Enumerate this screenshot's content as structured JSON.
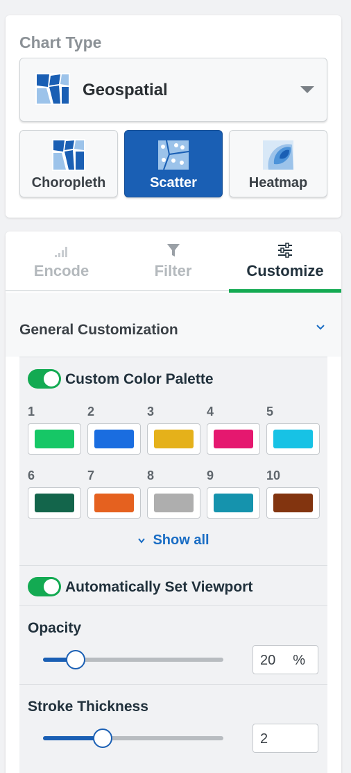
{
  "chart_type": {
    "section_label": "Chart Type",
    "selected": "Geospatial",
    "subtypes": [
      {
        "label": "Choropleth",
        "active": false
      },
      {
        "label": "Scatter",
        "active": true
      },
      {
        "label": "Heatmap",
        "active": false
      }
    ]
  },
  "tabs": [
    {
      "label": "Encode",
      "icon": "bar-signal-icon",
      "active": false
    },
    {
      "label": "Filter",
      "icon": "filter-icon",
      "active": false
    },
    {
      "label": "Customize",
      "icon": "sliders-icon",
      "active": true
    }
  ],
  "customize": {
    "general_title": "General Customization",
    "palette": {
      "toggle_on": true,
      "label": "Custom Color Palette",
      "colors": [
        {
          "n": "1",
          "hex": "#16c766"
        },
        {
          "n": "2",
          "hex": "#1a6de0"
        },
        {
          "n": "3",
          "hex": "#e5b11a"
        },
        {
          "n": "4",
          "hex": "#e5186f"
        },
        {
          "n": "5",
          "hex": "#17c2e5"
        },
        {
          "n": "6",
          "hex": "#13654b"
        },
        {
          "n": "7",
          "hex": "#e5611f"
        },
        {
          "n": "8",
          "hex": "#aeaeae"
        },
        {
          "n": "9",
          "hex": "#1593ad"
        },
        {
          "n": "10",
          "hex": "#82340f"
        }
      ],
      "show_all": "Show all"
    },
    "viewport": {
      "toggle_on": true,
      "label": "Automatically Set Viewport"
    },
    "opacity": {
      "label": "Opacity",
      "value": "20",
      "unit": "%",
      "slider_fraction": 0.18
    },
    "stroke": {
      "label": "Stroke Thickness",
      "value": "2",
      "slider_fraction": 0.33
    }
  },
  "colors": {
    "accent_blue": "#1a5fb4",
    "accent_green": "#13aa52"
  }
}
